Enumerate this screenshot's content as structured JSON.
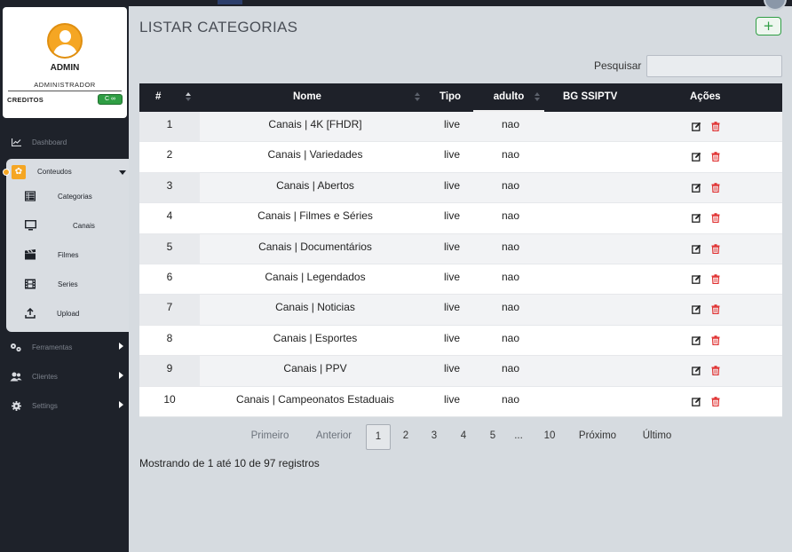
{
  "sidebar": {
    "profile": {
      "name": "ADMIN",
      "role": "ADMINISTRADOR",
      "credits_label": "CREDITOS",
      "credits_value": "∞"
    },
    "nav": [
      {
        "label": "Dashboard",
        "icon": "chart-line-icon"
      },
      {
        "label": "Conteudos",
        "icon": "gear-icon"
      },
      {
        "label": "Ferramentas",
        "icon": "gears-icon"
      },
      {
        "label": "Clientes",
        "icon": "users-icon"
      },
      {
        "label": "Settings",
        "icon": "gear-icon"
      }
    ],
    "submenu": [
      {
        "label": "Categorias",
        "icon": "list-icon"
      },
      {
        "label": "Canais",
        "icon": "monitor-icon"
      },
      {
        "label": "Filmes",
        "icon": "clapperboard-icon"
      },
      {
        "label": "Series",
        "icon": "film-icon"
      },
      {
        "label": "Upload",
        "icon": "upload-icon"
      }
    ]
  },
  "header": {
    "title": "LISTAR CATEGORIAS",
    "add_label": "+"
  },
  "search": {
    "label": "Pesquisar",
    "value": ""
  },
  "table": {
    "columns": [
      "#",
      "Nome",
      "Tipo",
      "adulto",
      "BG SSIPTV",
      "Ações"
    ],
    "rows": [
      {
        "id": "1",
        "nome": "Canais | 4K [FHDR]",
        "tipo": "live",
        "adulto": "nao",
        "bg": ""
      },
      {
        "id": "2",
        "nome": "Canais | Variedades",
        "tipo": "live",
        "adulto": "nao",
        "bg": ""
      },
      {
        "id": "3",
        "nome": "Canais | Abertos",
        "tipo": "live",
        "adulto": "nao",
        "bg": ""
      },
      {
        "id": "4",
        "nome": "Canais | Filmes e Séries",
        "tipo": "live",
        "adulto": "nao",
        "bg": ""
      },
      {
        "id": "5",
        "nome": "Canais | Documentários",
        "tipo": "live",
        "adulto": "nao",
        "bg": ""
      },
      {
        "id": "6",
        "nome": "Canais | Legendados",
        "tipo": "live",
        "adulto": "nao",
        "bg": ""
      },
      {
        "id": "7",
        "nome": "Canais | Noticias",
        "tipo": "live",
        "adulto": "nao",
        "bg": ""
      },
      {
        "id": "8",
        "nome": "Canais | Esportes",
        "tipo": "live",
        "adulto": "nao",
        "bg": ""
      },
      {
        "id": "9",
        "nome": "Canais | PPV",
        "tipo": "live",
        "adulto": "nao",
        "bg": ""
      },
      {
        "id": "10",
        "nome": "Canais | Campeonatos Estaduais",
        "tipo": "live",
        "adulto": "nao",
        "bg": ""
      }
    ]
  },
  "pagination": {
    "first": "Primeiro",
    "prev": "Anterior",
    "pages": [
      "1",
      "2",
      "3",
      "4",
      "5",
      "...",
      "10"
    ],
    "current": "1",
    "next": "Próximo",
    "last": "Último"
  },
  "info": "Mostrando de 1 até 10 de 97 registros",
  "colors": {
    "accent": "#f5a623",
    "sidebar": "#1e222a",
    "table_header": "#1e2129",
    "success": "#2f9e44",
    "danger": "#e03131"
  }
}
